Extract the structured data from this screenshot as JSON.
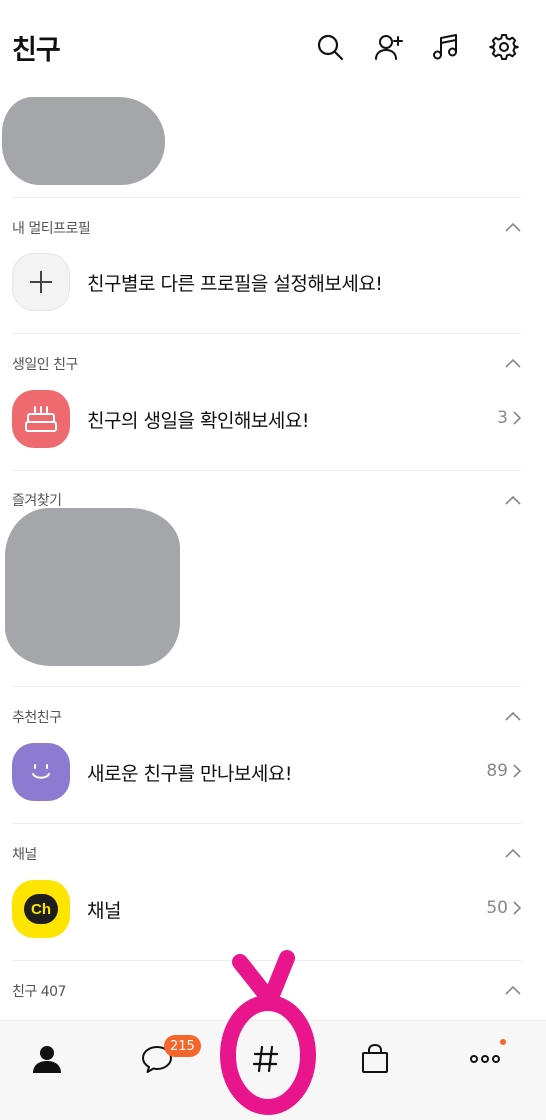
{
  "header": {
    "title": "친구",
    "icons": [
      "search-icon",
      "add-friend-icon",
      "music-icon",
      "settings-icon"
    ]
  },
  "sections": {
    "multi_profile": {
      "label": "내 멀티프로필",
      "text": "친구별로 다른 프로필을 설정해보세요!"
    },
    "birthday": {
      "label": "생일인 친구",
      "text": "친구의 생일을 확인해보세요!",
      "count": "3"
    },
    "favorites": {
      "label": "즐겨찾기"
    },
    "recommended": {
      "label": "추천친구",
      "text": "새로운 친구를 만나보세요!",
      "count": "89"
    },
    "channel": {
      "label": "채널",
      "text": "채널",
      "count": "50",
      "badge_text": "Ch"
    },
    "friends": {
      "label": "친구 407"
    }
  },
  "bottom_nav": {
    "items": [
      "friends-tab",
      "chats-tab",
      "hashtag-tab",
      "shopping-tab",
      "more-tab"
    ],
    "chat_badge": "215"
  },
  "colors": {
    "accent_badge": "#f4662c",
    "birthday": "#ee6a6f",
    "recommend": "#8c7bd0",
    "channel": "#fde500",
    "annotation": "#e8158c",
    "redaction": "#a5a6a9"
  }
}
